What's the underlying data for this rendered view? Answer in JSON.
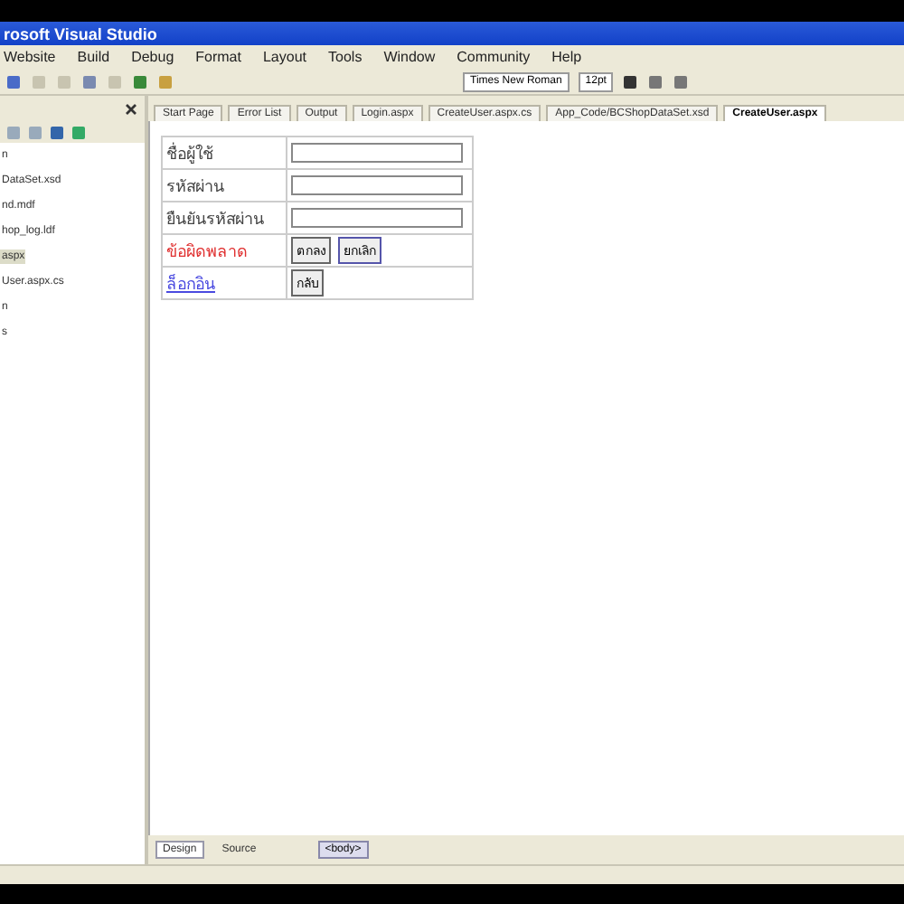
{
  "window": {
    "title": "rosoft Visual Studio"
  },
  "menu": [
    "Website",
    "Build",
    "Debug",
    "Format",
    "Layout",
    "Tools",
    "Window",
    "Community",
    "Help"
  ],
  "toolbar": {
    "font": "Times New Roman",
    "size": "12pt"
  },
  "solution_explorer": {
    "items": [
      {
        "label": "n",
        "selected": false
      },
      {
        "label": "DataSet.xsd",
        "selected": false
      },
      {
        "label": "nd.mdf",
        "selected": false
      },
      {
        "label": "hop_log.ldf",
        "selected": false
      },
      {
        "label": "aspx",
        "selected": true
      },
      {
        "label": "User.aspx.cs",
        "selected": false
      },
      {
        "label": "n",
        "selected": false
      },
      {
        "label": "s",
        "selected": false
      }
    ]
  },
  "tabs": [
    {
      "label": "Start Page",
      "selected": false
    },
    {
      "label": "Error List",
      "selected": false
    },
    {
      "label": "Output",
      "selected": false
    },
    {
      "label": "Login.aspx",
      "selected": false
    },
    {
      "label": "CreateUser.aspx.cs",
      "selected": false
    },
    {
      "label": "App_Code/BCShopDataSet.xsd",
      "selected": false
    },
    {
      "label": "CreateUser.aspx",
      "selected": true
    }
  ],
  "form": {
    "rows": [
      {
        "kind": "field",
        "label": "ชื่อผู้ใช้"
      },
      {
        "kind": "field",
        "label": "รหัสผ่าน"
      },
      {
        "kind": "field",
        "label": "ยืนยันรหัสผ่าน"
      },
      {
        "kind": "buttons",
        "label": "ข้อผิดพลาด",
        "buttons": [
          "ตกลง",
          "ยกเลิก"
        ]
      },
      {
        "kind": "link",
        "label": "ล็อกอิน",
        "buttons": [
          "กลับ"
        ]
      }
    ]
  },
  "view_tabs": [
    {
      "label": "Design",
      "selected": true
    },
    {
      "label": "Source",
      "selected": false
    }
  ],
  "tag_path": [
    "<body>"
  ]
}
